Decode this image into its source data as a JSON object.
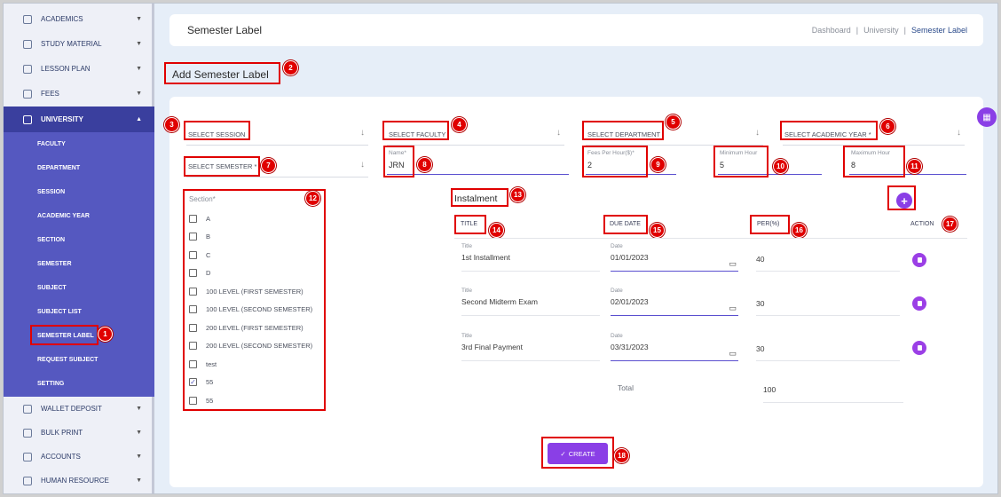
{
  "sidebar": {
    "items_top": [
      {
        "label": "ACADEMICS"
      },
      {
        "label": "STUDY MATERIAL"
      },
      {
        "label": "LESSON PLAN"
      },
      {
        "label": "FEES"
      },
      {
        "label": "UNIVERSITY"
      }
    ],
    "submenu": [
      {
        "label": "FACULTY"
      },
      {
        "label": "DEPARTMENT"
      },
      {
        "label": "SESSION"
      },
      {
        "label": "ACADEMIC YEAR"
      },
      {
        "label": "SECTION"
      },
      {
        "label": "SEMESTER"
      },
      {
        "label": "SUBJECT"
      },
      {
        "label": "SUBJECT LIST"
      },
      {
        "label": "SEMESTER LABEL"
      },
      {
        "label": "REQUEST SUBJECT"
      },
      {
        "label": "SETTING"
      }
    ],
    "items_bottom": [
      {
        "label": "WALLET DEPOSIT"
      },
      {
        "label": "BULK PRINT"
      },
      {
        "label": "ACCOUNTS"
      },
      {
        "label": "HUMAN RESOURCE"
      }
    ],
    "chevron_down": "▼",
    "chevron_up": "▲"
  },
  "header": {
    "title": "Semester Label",
    "breadcrumbs": [
      "Dashboard",
      "|",
      "University",
      "|",
      "Semester Label"
    ]
  },
  "page": {
    "heading": "Add Semester Label"
  },
  "form": {
    "session": "SELECT SESSION",
    "faculty": "SELECT FACULTY",
    "department": "SELECT DEPARTMENT",
    "academic_year": "SELECT ACADEMIC YEAR *",
    "semester": "SELECT SEMESTER *",
    "arrow": "↓",
    "name": {
      "label": "Name*",
      "value": "JRN"
    },
    "fees": {
      "label": "Fees Per Hour($)*",
      "value": "2"
    },
    "min_hour": {
      "label": "Minimum Hour",
      "value": "5"
    },
    "max_hour": {
      "label": "Maximum Hour",
      "value": "8"
    }
  },
  "sections": {
    "label": "Section*",
    "items": [
      {
        "label": "A",
        "mark": ""
      },
      {
        "label": "B",
        "mark": ""
      },
      {
        "label": "C",
        "mark": ""
      },
      {
        "label": "D",
        "mark": ""
      },
      {
        "label": "100 LEVEL (FIRST SEMESTER)",
        "mark": ""
      },
      {
        "label": "100 LEVEL (SECOND SEMESTER)",
        "mark": ""
      },
      {
        "label": "200 LEVEL (FIRST SEMESTER)",
        "mark": ""
      },
      {
        "label": "200 LEVEL (SECOND SEMESTER)",
        "mark": ""
      },
      {
        "label": "test",
        "mark": ""
      },
      {
        "label": "55",
        "mark": "✓"
      },
      {
        "label": "55",
        "mark": ""
      }
    ]
  },
  "instalment": {
    "title": "Instalment",
    "add_symbol": "+",
    "columns": {
      "title": "TITLE",
      "due_date": "DUE DATE",
      "per": "PER(%)",
      "action": "ACTION"
    },
    "rows": [
      {
        "title_label": "Title",
        "title": "1st Installment",
        "date_label": "Date",
        "date": "01/01/2023",
        "per": "40"
      },
      {
        "title_label": "Title",
        "title": "Second Midterm Exam",
        "date_label": "Date",
        "date": "02/01/2023",
        "per": "30"
      },
      {
        "title_label": "Title",
        "title": "3rd Final Payment",
        "date_label": "Date",
        "date": "03/31/2023",
        "per": "30"
      }
    ],
    "total_label": "Total",
    "total_value": "100"
  },
  "create_button": {
    "check": "✓",
    "label": "CREATE"
  },
  "annotations": [
    "1",
    "2",
    "3",
    "4",
    "5",
    "6",
    "7",
    "8",
    "9",
    "10",
    "11",
    "12",
    "13",
    "14",
    "15",
    "16",
    "17",
    "18"
  ],
  "colors": {
    "accent": "#8a3fe6",
    "sidebar_active": "#3a3f9e",
    "submenu": "#5558c0",
    "annotation": "#e00000"
  }
}
